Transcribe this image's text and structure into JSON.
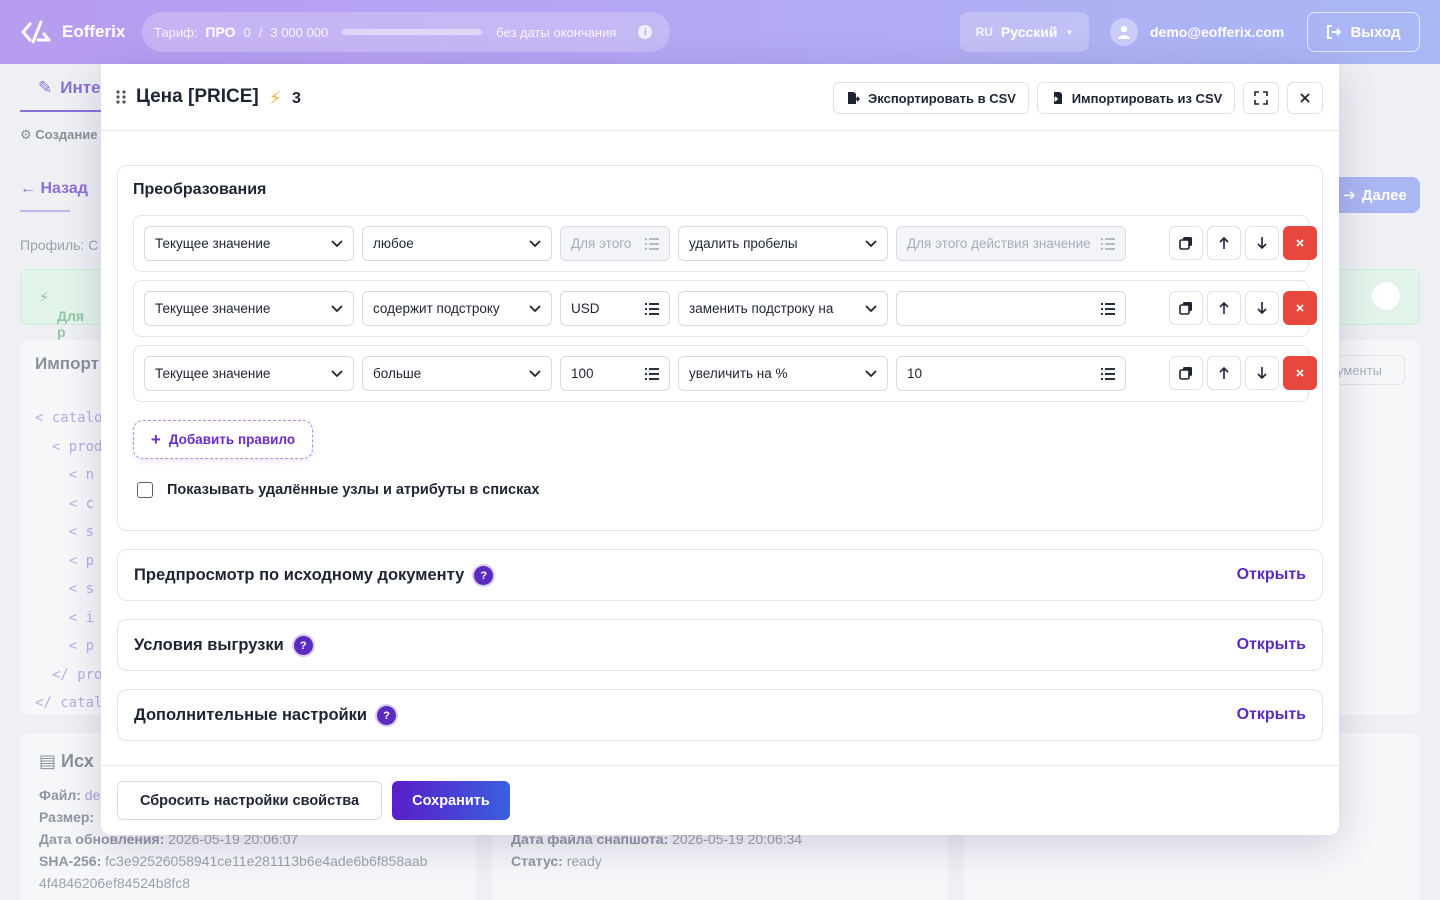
{
  "topbar": {
    "brand": "Eofferix",
    "tariff_label": "Тариф:",
    "tariff_plan": "ПРО",
    "usage_used": "0",
    "usage_sep": "/",
    "usage_total": "3 000 000",
    "usage_progress": 0,
    "expiry": "без даты окончания",
    "lang_code": "RU",
    "lang_name": "Русский",
    "user_email": "demo@eofferix.com",
    "logout_label": "Выход"
  },
  "background": {
    "tab_label": "Инте",
    "crumb": "Создание",
    "back_label": "Назад",
    "profile_label": "Профиль: С",
    "info_banner": "Для р",
    "next_label": "Далее",
    "import_title": "Импорт",
    "args_label": "ументы",
    "code_lines": [
      "< catalo",
      "  < prod",
      "    < n",
      "    < c",
      "    < s",
      "    < p",
      "    < s",
      "    < i",
      "    < p",
      "  </ pro",
      "</ catal"
    ],
    "source_title": "Исх",
    "file_label": "Файл:",
    "file_value": "de",
    "size_label": "Размер:",
    "updated_label": "Дата обновления:",
    "updated_value": "2026-05-19 20:06:07",
    "sha_label": "SHA-256:",
    "sha_value": "fc3e92526058941ce11e281113b6e4ade6b6f858aab",
    "sha_value2": "4f4846206ef84524b8fc8",
    "snapshot_label": "Дата файла снапшота:",
    "snapshot_value": "2026-05-19 20:06:34",
    "status_label": "Статус:",
    "status_value": "ready"
  },
  "modal": {
    "title": "Цена [PRICE]",
    "bolt_count": "3",
    "export_label": "Экспортировать в CSV",
    "import_label": "Импортировать из CSV",
    "transforms_title": "Преобразования",
    "rules": [
      {
        "source": "Текущее значение",
        "condition": "любое",
        "cond_value": "",
        "cond_placeholder": "Для этого",
        "cond_disabled": true,
        "action": "удалить пробелы",
        "action_value": "",
        "action_placeholder": "Для этого действия значение",
        "action_disabled": true
      },
      {
        "source": "Текущее значение",
        "condition": "содержит подстроку",
        "cond_value": "USD",
        "cond_placeholder": "",
        "cond_disabled": false,
        "action": "заменить подстроку на",
        "action_value": "",
        "action_placeholder": "",
        "action_disabled": false
      },
      {
        "source": "Текущее значение",
        "condition": "больше",
        "cond_value": "100",
        "cond_placeholder": "",
        "cond_disabled": false,
        "action": "увеличить на %",
        "action_value": "10",
        "action_placeholder": "",
        "action_disabled": false
      }
    ],
    "add_rule_label": "Добавить правило",
    "show_deleted_label": "Показывать удалённые узлы и атрибуты в списках",
    "show_deleted_checked": false,
    "sections": [
      {
        "title": "Предпросмотр по исходному документу",
        "action": "Открыть"
      },
      {
        "title": "Условия выгрузки",
        "action": "Открыть"
      },
      {
        "title": "Дополнительные настройки",
        "action": "Открыть"
      }
    ],
    "reset_label": "Сбросить настройки свойства",
    "save_label": "Сохранить"
  },
  "colors": {
    "accent": "#5a2bc0",
    "danger": "#e8473d",
    "bolt": "#f4b740"
  },
  "icons": [
    "logo-icon",
    "info-icon",
    "user-icon",
    "logout-icon",
    "drag-handle-icon",
    "bolt-icon",
    "export-icon",
    "import-icon",
    "fullscreen-icon",
    "close-icon",
    "chevron-down-icon",
    "list-icon",
    "copy-icon",
    "arrow-up-icon",
    "arrow-down-icon",
    "delete-icon",
    "plus-icon",
    "help-icon"
  ]
}
